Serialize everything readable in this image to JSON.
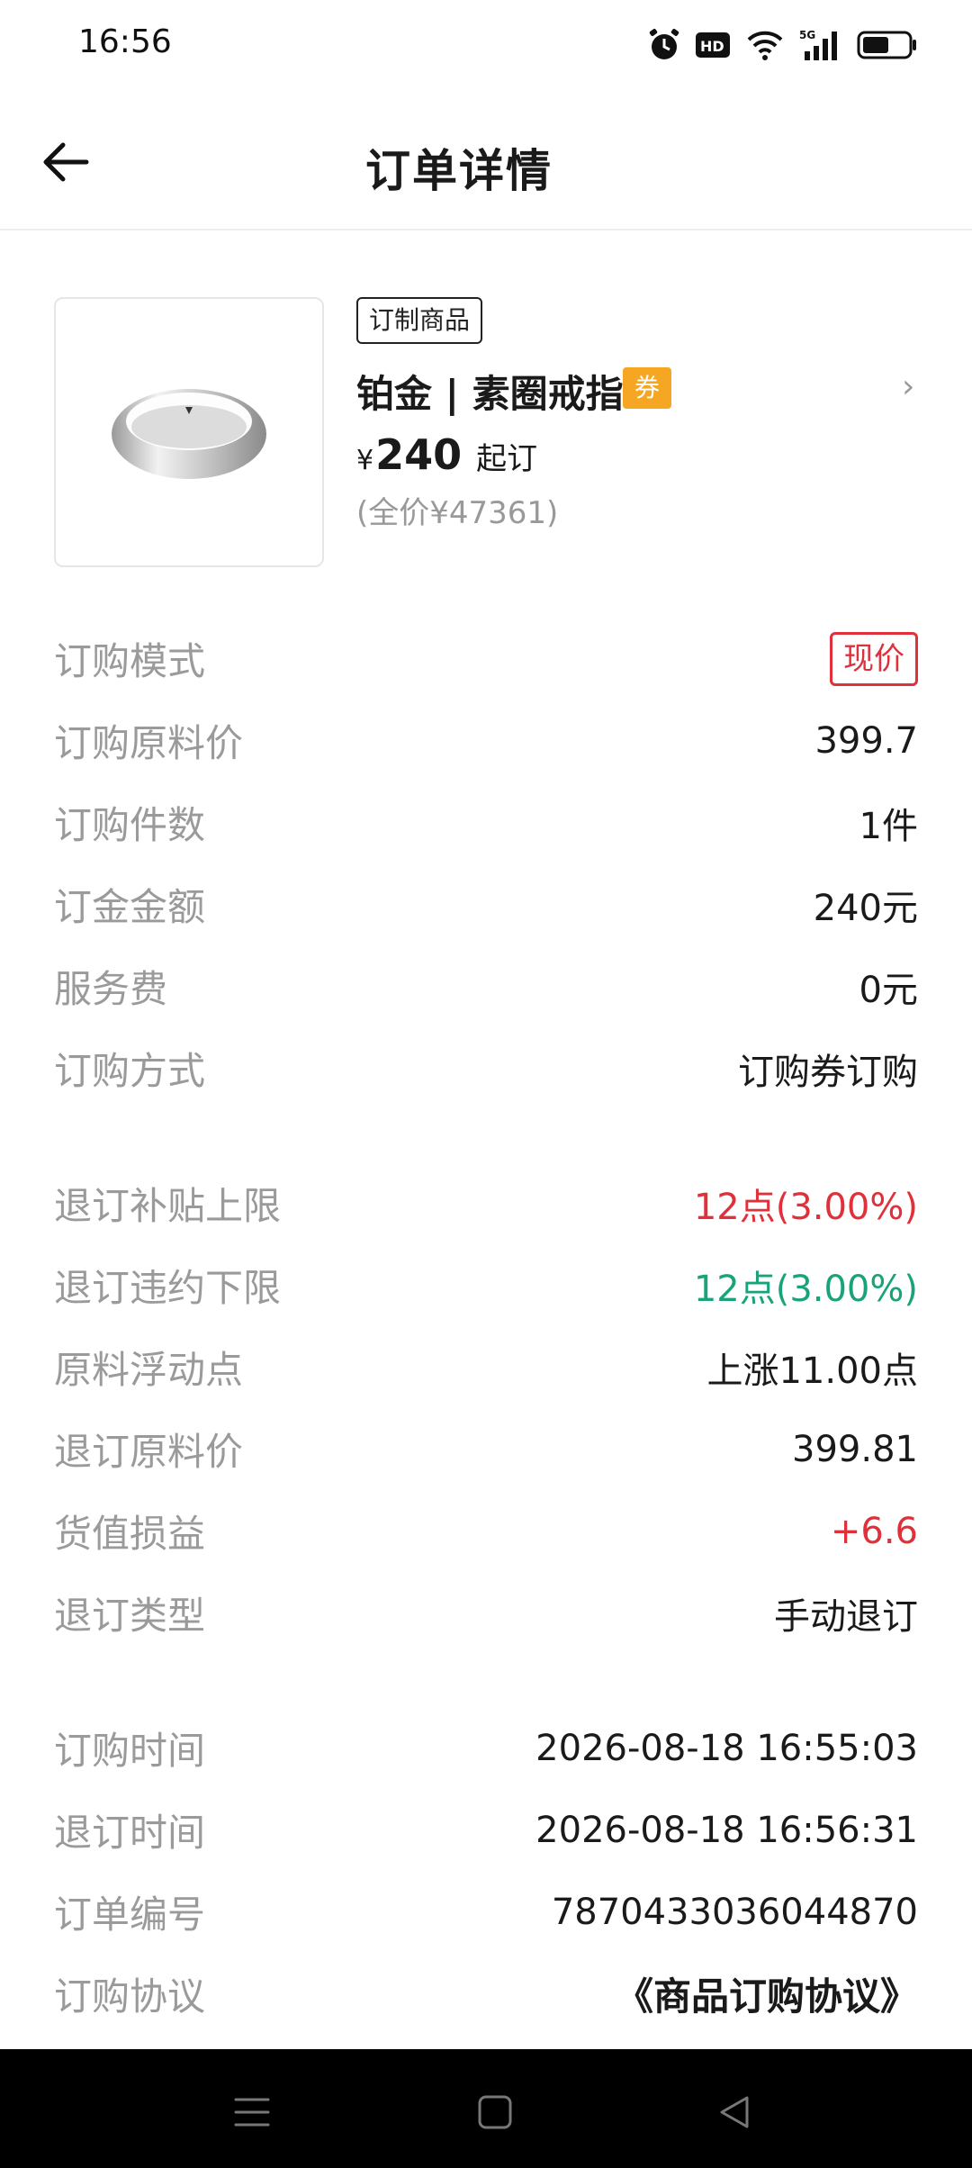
{
  "status_bar": {
    "time": "16:56",
    "icons": [
      "alarm-icon",
      "hd-icon",
      "wifi-icon",
      "5g-signal-icon",
      "battery-icon"
    ]
  },
  "header": {
    "title": "订单详情",
    "back_icon": "arrow-left-icon"
  },
  "product": {
    "tag": "订制商品",
    "name": "铂金 | 素圈戒指",
    "coupon_badge": "券",
    "price_symbol": "¥",
    "price": "240",
    "price_suffix": "起订",
    "full_price": "(全价¥47361)"
  },
  "group1": [
    {
      "label": "订购模式",
      "value": "现价"
    },
    {
      "label": "订购原料价",
      "value": "399.7"
    },
    {
      "label": "订购件数",
      "value": "1件"
    },
    {
      "label": "订金金额",
      "value": "240元"
    },
    {
      "label": "服务费",
      "value": "0元"
    },
    {
      "label": "订购方式",
      "value": "订购券订购"
    }
  ],
  "group2": [
    {
      "label": "退订补贴上限",
      "value": "12点(3.00%)"
    },
    {
      "label": "退订违约下限",
      "value": "12点(3.00%)"
    },
    {
      "label": "原料浮动点",
      "value": "上涨11.00点"
    },
    {
      "label": "退订原料价",
      "value": "399.81"
    },
    {
      "label": "货值损益",
      "value": "+6.6"
    },
    {
      "label": "退订类型",
      "value": "手动退订"
    }
  ],
  "group3": [
    {
      "label": "订购时间",
      "value": "2026-08-18 16:55:03"
    },
    {
      "label": "退订时间",
      "value": "2026-08-18 16:56:31"
    },
    {
      "label": "订单编号",
      "value": "7870433036044870"
    },
    {
      "label": "订购协议",
      "value": "《商品订购协议》"
    }
  ],
  "colors": {
    "red": "#e0303a",
    "green": "#1aa37a",
    "coupon": "#f5a623",
    "label_gray": "#9a9a9a"
  },
  "nav_bar": {
    "icons": [
      "menu-icon",
      "home-square-icon",
      "back-triangle-icon"
    ]
  }
}
